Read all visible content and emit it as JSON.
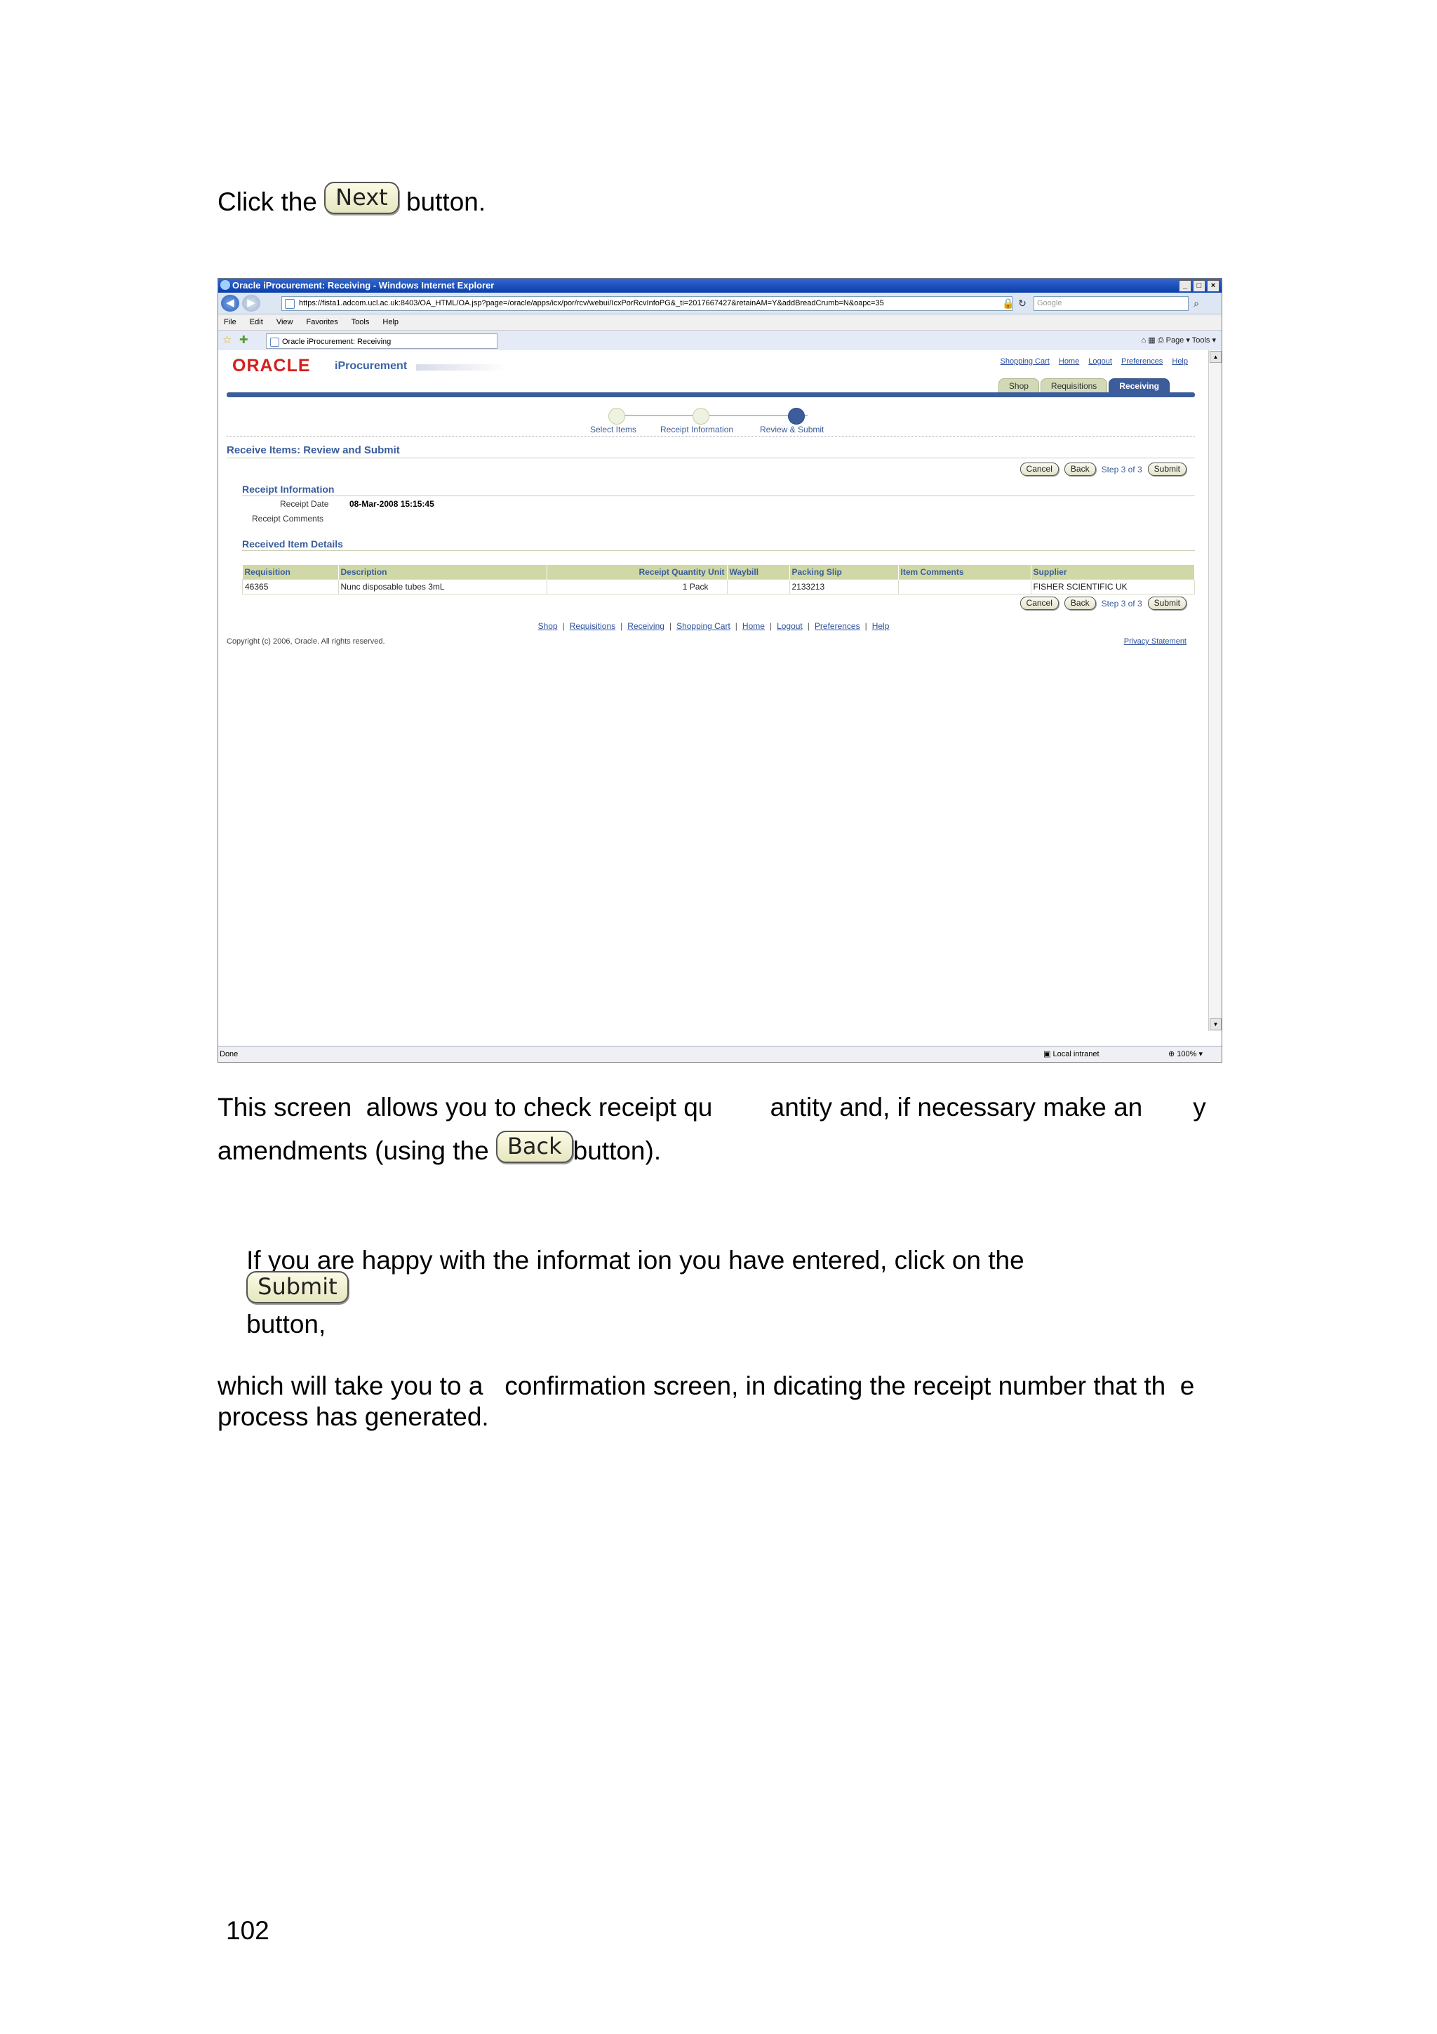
{
  "instructions": {
    "step1_prefix": "Click the",
    "step1_button": "Next",
    "step1_suffix": "button.",
    "para1_line1": "This screen  allows you to check receipt qu        antity and, if necessary make an       y",
    "para1_line2_prefix": "amendments (using the",
    "para1_button": "Back",
    "para1_line2_suffix": "button).",
    "para2_line1_prefix": "If you are happy with the informat ion you have entered, click on the",
    "para2_button": "Submit",
    "para2_line1_suffix": "button,",
    "para2_line2": "which will take you to a   confirmation screen, in dicating the receipt number that th  e",
    "para2_line3": "process has generated."
  },
  "browser": {
    "title": "Oracle iProcurement: Receiving - Windows Internet Explorer",
    "url": "https://fista1.adcom.ucl.ac.uk:8403/OA_HTML/OA.jsp?page=/oracle/apps/icx/por/rcv/webui/IcxPorRcvInfoPG&_ti=2017667427&retainAM=Y&addBreadCrumb=N&oapc=35",
    "search_placeholder": "Google",
    "menu": [
      "File",
      "Edit",
      "View",
      "Favorites",
      "Tools",
      "Help"
    ],
    "tab_label": "Oracle iProcurement: Receiving",
    "commands": "Page ▾   Tools ▾",
    "status": "Done",
    "zone": "Local intranet",
    "zoom": "100%"
  },
  "app": {
    "logo": "ORACLE",
    "product": "iProcurement",
    "global_links": [
      "Shopping Cart",
      "Home",
      "Logout",
      "Preferences",
      "Help"
    ],
    "tabs": [
      "Shop",
      "Requisitions",
      "Receiving"
    ],
    "active_tab": "Receiving",
    "train": [
      "Select Items",
      "Receipt Information",
      "Review & Submit"
    ],
    "page_title": "Receive Items: Review and Submit",
    "buttons": {
      "cancel": "Cancel",
      "back": "Back",
      "submit": "Submit",
      "step": "Step 3 of 3"
    },
    "receipt_info": {
      "heading": "Receipt Information",
      "date_label": "Receipt Date",
      "date_value": "08-Mar-2008 15:15:45",
      "comments_label": "Receipt Comments"
    },
    "items": {
      "heading": "Received Item Details",
      "columns": [
        "Requisition",
        "Description",
        "Receipt Quantity Unit",
        "Waybill",
        "Packing Slip",
        "Item Comments",
        "Supplier"
      ],
      "rows": [
        {
          "requisition": "46365",
          "description": "Nunc disposable tubes 3mL",
          "quantity": "1",
          "unit": "Pack",
          "waybill": "",
          "packing_slip": "2133213",
          "item_comments": "",
          "supplier": "FISHER SCIENTIFIC UK"
        }
      ]
    },
    "footer_links": [
      "Shop",
      "Requisitions",
      "Receiving",
      "Shopping Cart",
      "Home",
      "Logout",
      "Preferences",
      "Help"
    ],
    "copyright": "Copyright (c) 2006, Oracle. All rights reserved.",
    "privacy": "Privacy Statement"
  },
  "page_number": "102"
}
